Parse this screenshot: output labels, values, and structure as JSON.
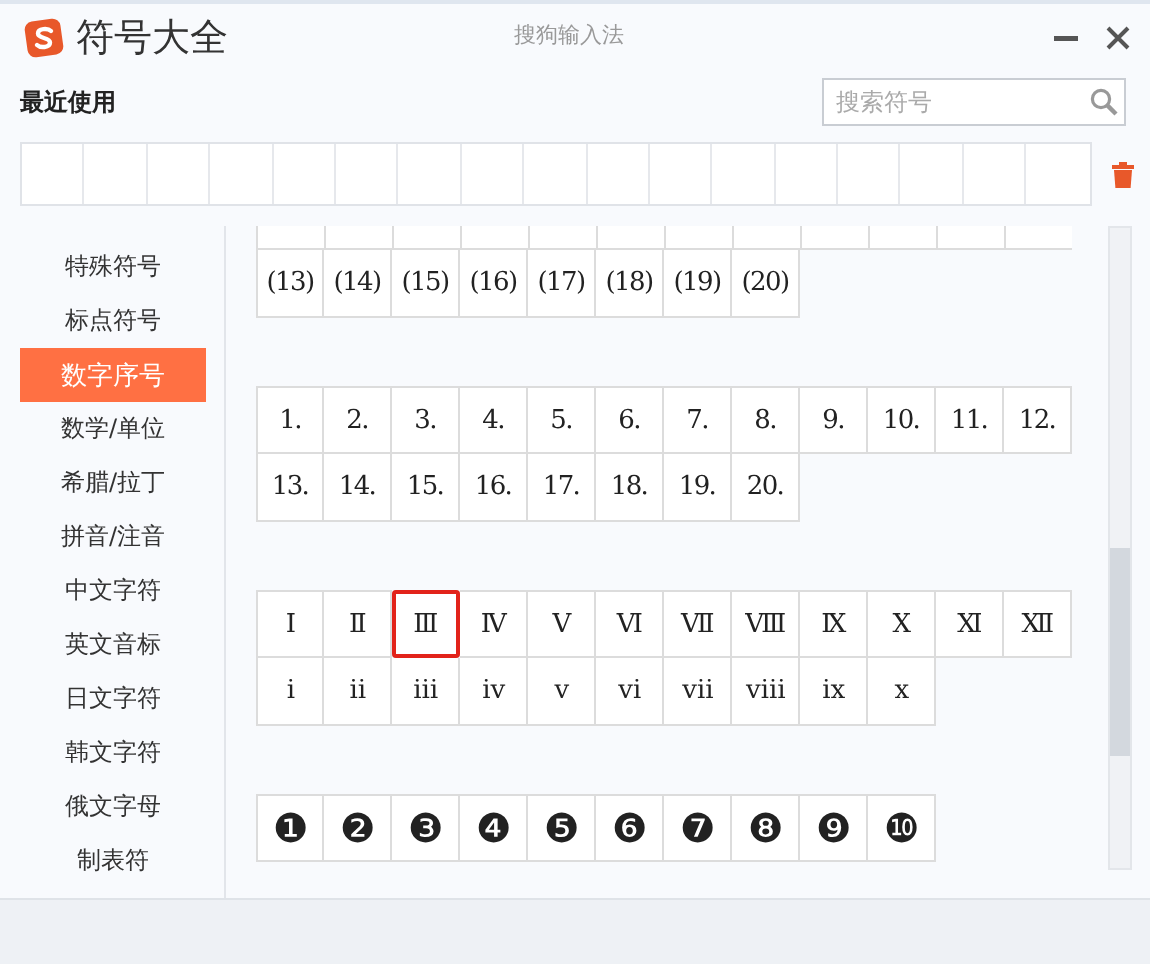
{
  "window": {
    "title": "符号大全",
    "subtitle": "搜狗输入法"
  },
  "recent": {
    "label": "最近使用"
  },
  "search": {
    "placeholder": "搜索符号"
  },
  "sidebar": {
    "items": [
      {
        "label": "特殊符号",
        "selected": false
      },
      {
        "label": "标点符号",
        "selected": false
      },
      {
        "label": "数字序号",
        "selected": true
      },
      {
        "label": "数学/单位",
        "selected": false
      },
      {
        "label": "希腊/拉丁",
        "selected": false
      },
      {
        "label": "拼音/注音",
        "selected": false
      },
      {
        "label": "中文字符",
        "selected": false
      },
      {
        "label": "英文音标",
        "selected": false
      },
      {
        "label": "日文字符",
        "selected": false
      },
      {
        "label": "韩文字符",
        "selected": false
      },
      {
        "label": "俄文字母",
        "selected": false
      },
      {
        "label": "制表符",
        "selected": false
      }
    ]
  },
  "groups": [
    {
      "rows": [
        [
          {
            "text": "(13)",
            "selected": false
          },
          {
            "text": "(14)",
            "selected": false
          },
          {
            "text": "(15)",
            "selected": false
          },
          {
            "text": "(16)",
            "selected": false
          },
          {
            "text": "(17)",
            "selected": false
          },
          {
            "text": "(18)",
            "selected": false
          },
          {
            "text": "(19)",
            "selected": false
          },
          {
            "text": "(20)",
            "selected": false
          }
        ]
      ]
    },
    {
      "rows": [
        [
          {
            "text": "1.",
            "selected": false
          },
          {
            "text": "2.",
            "selected": false
          },
          {
            "text": "3.",
            "selected": false
          },
          {
            "text": "4.",
            "selected": false
          },
          {
            "text": "5.",
            "selected": false
          },
          {
            "text": "6.",
            "selected": false
          },
          {
            "text": "7.",
            "selected": false
          },
          {
            "text": "8.",
            "selected": false
          },
          {
            "text": "9.",
            "selected": false
          },
          {
            "text": "10.",
            "selected": false
          },
          {
            "text": "11.",
            "selected": false
          },
          {
            "text": "12.",
            "selected": false
          }
        ],
        [
          {
            "text": "13.",
            "selected": false
          },
          {
            "text": "14.",
            "selected": false
          },
          {
            "text": "15.",
            "selected": false
          },
          {
            "text": "16.",
            "selected": false
          },
          {
            "text": "17.",
            "selected": false
          },
          {
            "text": "18.",
            "selected": false
          },
          {
            "text": "19.",
            "selected": false
          },
          {
            "text": "20.",
            "selected": false
          }
        ]
      ]
    },
    {
      "rows": [
        [
          {
            "text": "Ⅰ",
            "selected": false
          },
          {
            "text": "Ⅱ",
            "selected": false
          },
          {
            "text": "Ⅲ",
            "selected": true
          },
          {
            "text": "Ⅳ",
            "selected": false
          },
          {
            "text": "Ⅴ",
            "selected": false
          },
          {
            "text": "Ⅵ",
            "selected": false
          },
          {
            "text": "Ⅶ",
            "selected": false
          },
          {
            "text": "Ⅷ",
            "selected": false
          },
          {
            "text": "Ⅸ",
            "selected": false
          },
          {
            "text": "Ⅹ",
            "selected": false
          },
          {
            "text": "Ⅺ",
            "selected": false
          },
          {
            "text": "Ⅻ",
            "selected": false
          }
        ],
        [
          {
            "text": "ⅰ",
            "selected": false
          },
          {
            "text": "ⅱ",
            "selected": false
          },
          {
            "text": "ⅲ",
            "selected": false
          },
          {
            "text": "ⅳ",
            "selected": false
          },
          {
            "text": "ⅴ",
            "selected": false
          },
          {
            "text": "ⅵ",
            "selected": false
          },
          {
            "text": "ⅶ",
            "selected": false
          },
          {
            "text": "ⅷ",
            "selected": false
          },
          {
            "text": "ⅸ",
            "selected": false
          },
          {
            "text": "ⅹ",
            "selected": false
          }
        ]
      ]
    },
    {
      "rows": [
        [
          {
            "text": "❶",
            "selected": false
          },
          {
            "text": "❷",
            "selected": false
          },
          {
            "text": "❸",
            "selected": false
          },
          {
            "text": "❹",
            "selected": false
          },
          {
            "text": "❺",
            "selected": false
          },
          {
            "text": "❻",
            "selected": false
          },
          {
            "text": "❼",
            "selected": false
          },
          {
            "text": "❽",
            "selected": false
          },
          {
            "text": "❾",
            "selected": false
          },
          {
            "text": "❿",
            "selected": false
          }
        ]
      ]
    }
  ]
}
